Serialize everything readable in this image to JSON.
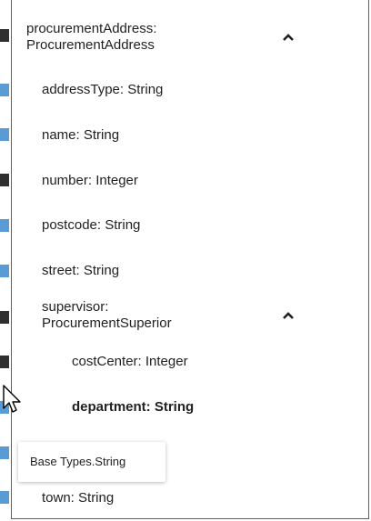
{
  "tree": {
    "root": {
      "label": "procurementAddress:\nProcurementAddress",
      "icon": "chevron-up-icon"
    },
    "fields": [
      {
        "label": "addressType: String"
      },
      {
        "label": "name: String"
      },
      {
        "label": "number: Integer"
      },
      {
        "label": "postcode: String"
      },
      {
        "label": "street: String"
      }
    ],
    "supervisor": {
      "label": "supervisor:\nProcurementSuperior",
      "icon": "chevron-up-icon",
      "children": [
        {
          "label": "costCenter: Integer"
        },
        {
          "label": "department: String"
        }
      ]
    },
    "hidden_child": {
      "label": ""
    },
    "town": {
      "label": "town: String"
    }
  },
  "tooltip": {
    "text": "Base Types.String"
  },
  "colors": {
    "rail_blue": "#5b9bd5",
    "rail_dark": "#2f2f2f",
    "border": "#606060"
  }
}
